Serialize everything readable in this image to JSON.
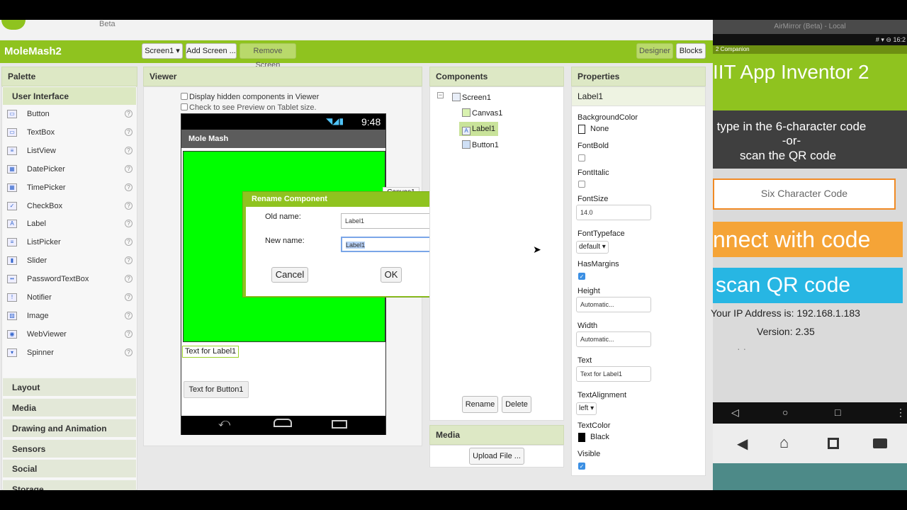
{
  "app": {
    "beta_label": "Beta",
    "project_name": "MoleMash2",
    "screen_dropdown": "Screen1 ▾",
    "add_screen": "Add Screen ...",
    "remove_screen": "Remove Screen",
    "designer": "Designer",
    "blocks": "Blocks"
  },
  "palette": {
    "title": "Palette",
    "section": "User Interface",
    "items": [
      {
        "label": "Button",
        "icon": "button-icon"
      },
      {
        "label": "TextBox",
        "icon": "textbox-icon"
      },
      {
        "label": "ListView",
        "icon": "listview-icon"
      },
      {
        "label": "DatePicker",
        "icon": "datepicker-icon"
      },
      {
        "label": "TimePicker",
        "icon": "timepicker-icon"
      },
      {
        "label": "CheckBox",
        "icon": "checkbox-icon"
      },
      {
        "label": "Label",
        "icon": "label-icon"
      },
      {
        "label": "ListPicker",
        "icon": "listpicker-icon"
      },
      {
        "label": "Slider",
        "icon": "slider-icon"
      },
      {
        "label": "PasswordTextBox",
        "icon": "passwordtextbox-icon"
      },
      {
        "label": "Notifier",
        "icon": "notifier-icon"
      },
      {
        "label": "Image",
        "icon": "image-icon"
      },
      {
        "label": "WebViewer",
        "icon": "webviewer-icon"
      },
      {
        "label": "Spinner",
        "icon": "spinner-icon"
      }
    ],
    "help_glyph": "?",
    "categories": [
      "Layout",
      "Media",
      "Drawing and Animation",
      "Sensors",
      "Social",
      "Storage"
    ]
  },
  "viewer": {
    "title": "Viewer",
    "hidden_components": "Display hidden components in Viewer",
    "tablet_preview": "Check to see Preview on Tablet size.",
    "phone_time": "9:48",
    "app_title": "Mole Mash",
    "label_text": "Text for Label1",
    "button_text": "Text for Button1",
    "canvas_tooltip": "Canvas1"
  },
  "dialog": {
    "title": "Rename Component",
    "old_name_label": "Old name:",
    "old_name_value": "Label1",
    "new_name_label": "New name:",
    "new_name_value": "Label1",
    "cancel": "Cancel",
    "ok": "OK"
  },
  "components": {
    "title": "Components",
    "tree": [
      {
        "label": "Screen1",
        "icon": "screen-icon"
      },
      {
        "label": "Canvas1",
        "icon": "canvas-icon"
      },
      {
        "label": "Label1",
        "icon": "label-icon"
      },
      {
        "label": "Button1",
        "icon": "button-icon"
      }
    ],
    "rename": "Rename",
    "delete": "Delete"
  },
  "media": {
    "title": "Media",
    "upload": "Upload File ..."
  },
  "properties": {
    "title": "Properties",
    "component": "Label1",
    "background_color_label": "BackgroundColor",
    "background_color_value": "None",
    "fontbold_label": "FontBold",
    "fontitalic_label": "FontItalic",
    "fontsize_label": "FontSize",
    "fontsize_value": "14.0",
    "fonttypeface_label": "FontTypeface",
    "fonttypeface_value": "default ▾",
    "hasmargins_label": "HasMargins",
    "height_label": "Height",
    "height_value": "Automatic...",
    "width_label": "Width",
    "width_value": "Automatic...",
    "text_label": "Text",
    "text_value": "Text for Label1",
    "textalignment_label": "TextAlignment",
    "textalignment_value": "left ▾",
    "textcolor_label": "TextColor",
    "textcolor_value": "Black",
    "visible_label": "Visible",
    "fontbold": false,
    "fontitalic": false,
    "hasmargins": true,
    "visible": true
  },
  "airmirror": {
    "window_title": "AirMirror (Beta) - Local",
    "status_time": "# ▾ ⊖ 16:2",
    "appbar": "2 Companion",
    "header": "IIT App Inventor 2",
    "line1": "type in the 6-character code",
    "line2": "-or-",
    "line3": "scan the QR code",
    "code_placeholder": "Six Character Code",
    "connect": "nnect with code",
    "scan": "scan QR code",
    "ip": "Your IP Address is:  192.168.1.183",
    "version": "Version:  2.35",
    "dots": "· ·"
  },
  "colors": {
    "brand_green": "#8fc31f",
    "canvas_green": "#00ff00",
    "connect_orange": "#f5a437",
    "scan_blue": "#27b6e3"
  }
}
